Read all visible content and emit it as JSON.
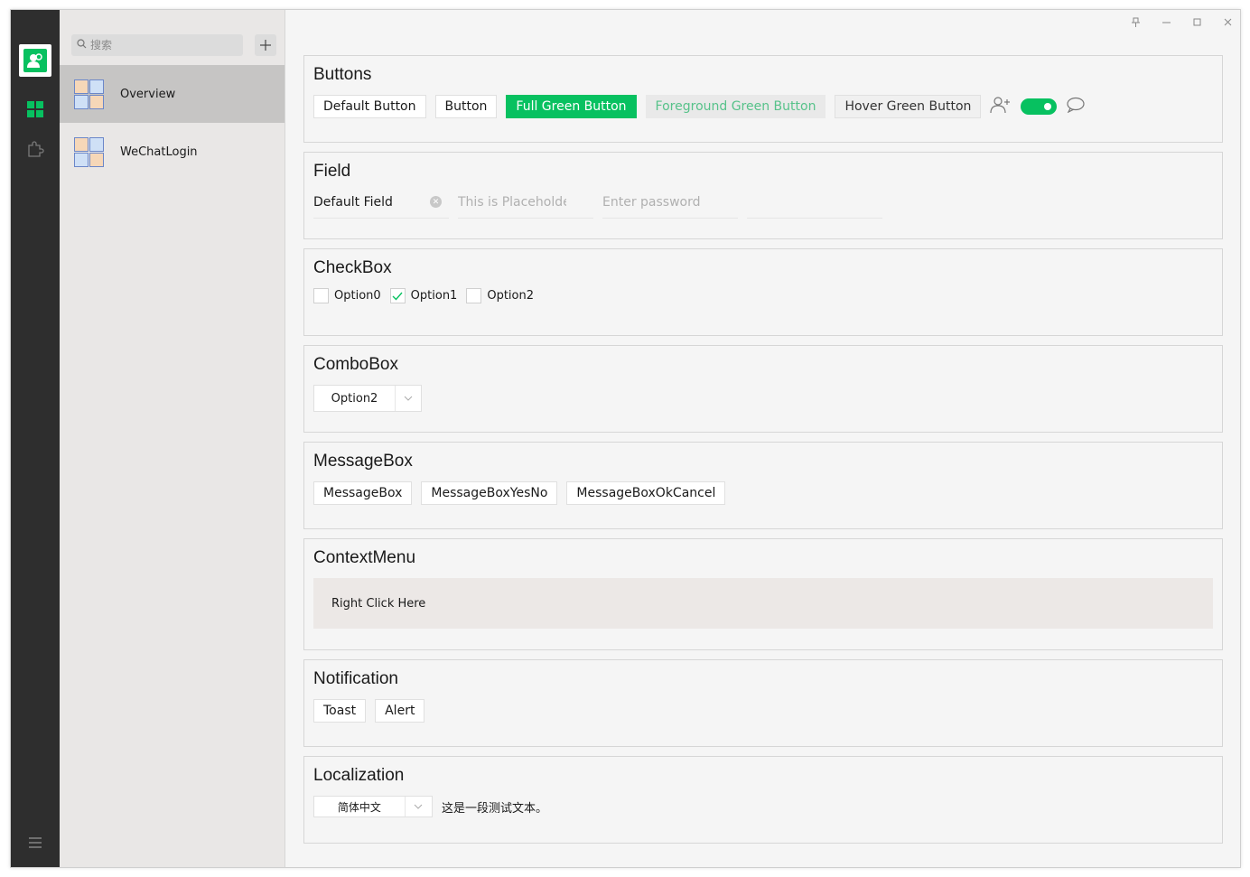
{
  "sidebar": {
    "icons": [
      "avatar-icon",
      "grid-icon",
      "plugin-icon",
      "menu-icon"
    ]
  },
  "list": {
    "search_placeholder": "搜索",
    "items": [
      {
        "label": "Overview",
        "active": true
      },
      {
        "label": "WeChatLogin",
        "active": false
      }
    ]
  },
  "sections": {
    "buttons": {
      "title": "Buttons",
      "default_button": "Default Button",
      "button": "Button",
      "full_green": "Full Green Button",
      "foreground_green": "Foreground Green Button",
      "hover_green": "Hover Green Button",
      "toggle_on": true
    },
    "field": {
      "title": "Field",
      "default_value": "Default Field",
      "placeholder": "This is Placeholder",
      "password_placeholder": "Enter password"
    },
    "checkbox": {
      "title": "CheckBox",
      "options": [
        {
          "label": "Option0",
          "checked": false
        },
        {
          "label": "Option1",
          "checked": true
        },
        {
          "label": "Option2",
          "checked": false
        }
      ]
    },
    "combobox": {
      "title": "ComboBox",
      "selected": "Option2"
    },
    "messagebox": {
      "title": "MessageBox",
      "buttons": [
        "MessageBox",
        "MessageBoxYesNo",
        "MessageBoxOkCancel"
      ]
    },
    "contextmenu": {
      "title": "ContextMenu",
      "area_text": "Right Click Here"
    },
    "notification": {
      "title": "Notification",
      "toast": "Toast",
      "alert": "Alert"
    },
    "localization": {
      "title": "Localization",
      "selected": "简体中文",
      "sample_text": "这是一段测试文本。"
    }
  },
  "colors": {
    "accent": "#07c160",
    "rail_bg": "#2e2e2e",
    "list_bg": "#e9e7e6"
  }
}
